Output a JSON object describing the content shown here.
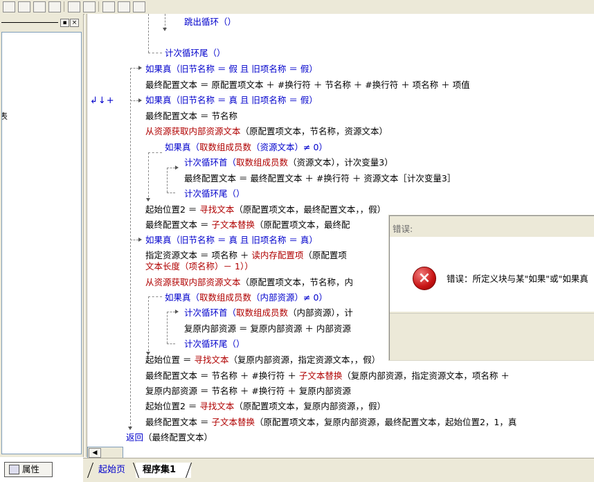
{
  "left_panel": {
    "list_fragment": "表",
    "props_tab_label": "属性",
    "min_button": "▪",
    "close_button": "×"
  },
  "editor": {
    "gutter_marker": "↲↓+",
    "lines": {
      "l01": "跳出循环（）",
      "l02a": "计次循环尾",
      "l02b": "（）",
      "l03a": "如果真",
      "l03b": "（旧节名称 ＝ 假 且 旧项名称 ＝ 假）",
      "l04": "最终配置文本 ＝ 原配置项文本 ＋ #换行符 ＋ 节名称 ＋ #换行符 ＋ 项名称 ＋ 项值",
      "l05a": "如果真",
      "l05b": "（旧节名称 ＝ 真 且 旧项名称 ＝ 假）",
      "l06": "最终配置文本 ＝ 节名称",
      "l07a": "从资源获取内部资源文本",
      "l07b": "（原配置项文本，节名称，资源文本）",
      "l08a": "如果真",
      "l08b": "（",
      "l08c": "取数组成员数",
      "l08d": "（资源文本）≠ 0）",
      "l09a": "计次循环首",
      "l09b": "（",
      "l09c": "取数组成员数",
      "l09d": "（资源文本），计次变量3）",
      "l10": "最终配置文本 ＝ 最终配置文本 ＋ #换行符 ＋ 资源文本［计次变量3］",
      "l11": "计次循环尾（）",
      "l12a": "起始位置2 ＝ ",
      "l12b": "寻找文本",
      "l12c": "（原配置项文本，最终配置文本，，假）",
      "l13a": "最终配置文本 ＝ ",
      "l13b": "子文本替换",
      "l13c": "（原配置项文本，最终配",
      "l14a": "如果真",
      "l14b": "（旧节名称 ＝ 真 且 旧项名称 ＝ 真）",
      "l15a": "指定资源文本 ＝ 项名称 ＋ ",
      "l15b": "读内存配置项",
      "l15c": "（原配置项",
      "l16a": "文本长度",
      "l16b": "（项名称）－ 1））",
      "l17a": "从资源获取内部资源文本",
      "l17b": "（原配置项文本，节名称，内",
      "l18a": "如果真",
      "l18b": "（",
      "l18c": "取数组成员数",
      "l18d": "（内部资源）≠ 0）",
      "l19a": "计次循环首",
      "l19b": "（",
      "l19c": "取数组成员数",
      "l19d": "（内部资源），计",
      "l20": "复原内部资源 ＝ 复原内部资源 ＋ 内部资源",
      "l21": "计次循环尾（）",
      "l22a": "起始位置 ＝ ",
      "l22b": "寻找文本",
      "l22c": "（复原内部资源，指定资源文本，，假）",
      "l23a": "最终配置文本 ＝ 节名称 ＋ #换行符 ＋ ",
      "l23b": "子文本替换",
      "l23c": "（复原内部资源，指定资源文本，项名称 ＋",
      "l24": "复原内部资源 ＝ 节名称 ＋ #换行符 ＋ 复原内部资源",
      "l25a": "起始位置2 ＝ ",
      "l25b": "寻找文本",
      "l25c": "（原配置项文本，复原内部资源，，假）",
      "l26a": "最终配置文本 ＝ ",
      "l26b": "子文本替换",
      "l26c": "（原配置项文本，复原内部资源，最终配置文本，起始位置2，1，真",
      "l27a": "返回",
      "l27b": "（最终配置文本）"
    }
  },
  "tabs": {
    "start_page": "起始页",
    "program_set": "程序集1"
  },
  "dialog": {
    "title": "错误:",
    "message": "错误：所定义块与某\"如果\"或\"如果真",
    "icon": "error-icon"
  },
  "colors": {
    "keyword_blue": "#0000cc",
    "keyword_red": "#b00000",
    "chrome": "#ece9d8"
  }
}
